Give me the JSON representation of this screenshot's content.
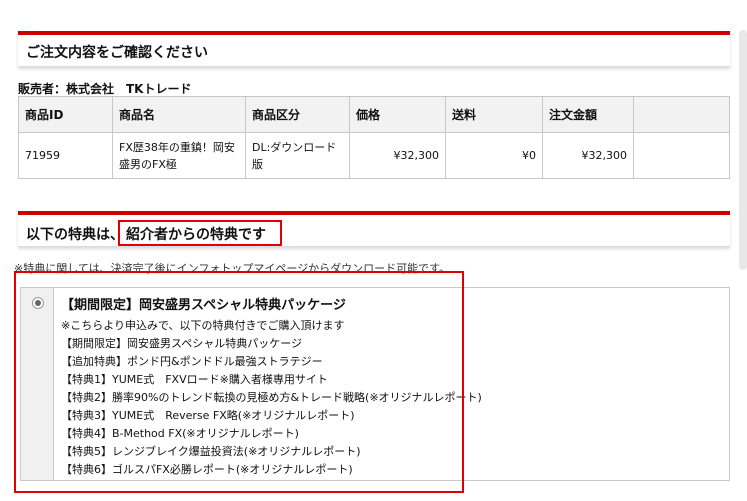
{
  "confirm": {
    "heading": "ご注文内容をご確認ください"
  },
  "seller": {
    "label": "販売者：株式会社　TKトレード"
  },
  "table": {
    "headers": [
      "商品ID",
      "商品名",
      "商品区分",
      "価格",
      "送料",
      "注文金額",
      ""
    ],
    "row": {
      "id": "71959",
      "name": "FX歴38年の重鎮！岡安盛男のFX極",
      "category": "DL:ダウンロード版",
      "price": "¥32,300",
      "shipping": "¥0",
      "total": "¥32,300",
      "extra": ""
    }
  },
  "bonus_section": {
    "heading_prefix": "以下の特典は、",
    "heading_highlight": "紹介者からの特典です",
    "note": "※特典に関しては、決済完了後にインフォトップマイページからダウンロード可能です。"
  },
  "bonus": {
    "title": "【期間限定】岡安盛男スペシャル特典パッケージ",
    "items": [
      "※こちらより申込みで、以下の特典付きでご購入頂けます",
      "【期間限定】岡安盛男スペシャル特典パッケージ",
      "【追加特典】ポンド円&ポンドドル最強ストラテジー",
      "【特典1】YUME式　FXVロード※購入者様専用サイト",
      "【特典2】勝率90%のトレンド転換の見極め方&トレード戦略(※オリジナルレポート)",
      "【特典3】YUME式　Reverse FX略(※オリジナルレポート)",
      "【特典4】B-Method FX(※オリジナルレポート)",
      "【特典5】レンジブレイク爆益投資法(※オリジナルレポート)",
      "【特典6】ゴルスパFX必勝レポート(※オリジナルレポート)"
    ]
  }
}
